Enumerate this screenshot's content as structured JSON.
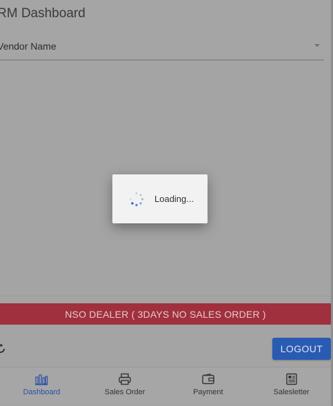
{
  "header": {
    "title": "RM Dashboard",
    "vendor_select": {
      "value": "Vendor Name"
    }
  },
  "banner": {
    "text": "NSO DEALER ( 3DAYS NO SALES ORDER )",
    "color": "#a0303e"
  },
  "actions": {
    "logout_label": "LOGOUT",
    "logout_color": "#2a5bb3"
  },
  "bottom_nav": {
    "items": [
      {
        "label": "Dashboard",
        "icon": "bar-chart-icon",
        "active": true
      },
      {
        "label": "Sales Order",
        "icon": "printer-icon",
        "active": false
      },
      {
        "label": "Payment",
        "icon": "wallet-icon",
        "active": false
      },
      {
        "label": "Salesletter",
        "icon": "newspaper-icon",
        "active": false
      }
    ]
  },
  "loading": {
    "text": "Loading..."
  }
}
